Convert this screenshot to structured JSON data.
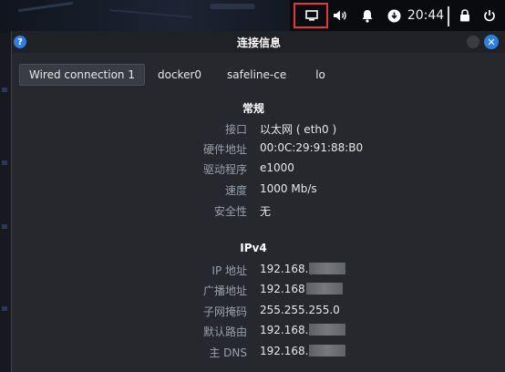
{
  "panel": {
    "time": "20:44",
    "icons": [
      "display-icon",
      "volume-icon",
      "bell-icon",
      "download-icon",
      "lock-icon",
      "power-icon"
    ]
  },
  "dialog": {
    "title": "连接信息",
    "app_icon_glyph": "?",
    "close_glyph": "✕"
  },
  "tabs": [
    {
      "label": "Wired connection 1",
      "active": true
    },
    {
      "label": "docker0",
      "active": false
    },
    {
      "label": "safeline-ce",
      "active": false
    },
    {
      "label": "lo",
      "active": false
    }
  ],
  "general": {
    "heading": "常规",
    "rows": [
      {
        "label": "接口",
        "value": "以太网 ( eth0 )"
      },
      {
        "label": "硬件地址",
        "value": "00:0C:29:91:88:B0"
      },
      {
        "label": "驱动程序",
        "value": "e1000"
      },
      {
        "label": "速度",
        "value": "1000 Mb/s"
      },
      {
        "label": "安全性",
        "value": "无"
      }
    ]
  },
  "ipv4": {
    "heading": "IPv4",
    "rows": [
      {
        "label": "IP 地址",
        "value": "192.168.",
        "redacted": true
      },
      {
        "label": "广播地址",
        "value": "192.168",
        "redacted": true
      },
      {
        "label": "子网掩码",
        "value": "255.255.255.0",
        "redacted": false
      },
      {
        "label": "默认路由",
        "value": "192.168.",
        "redacted": true
      },
      {
        "label": "主 DNS",
        "value": "192.168.",
        "redacted": true
      }
    ]
  }
}
